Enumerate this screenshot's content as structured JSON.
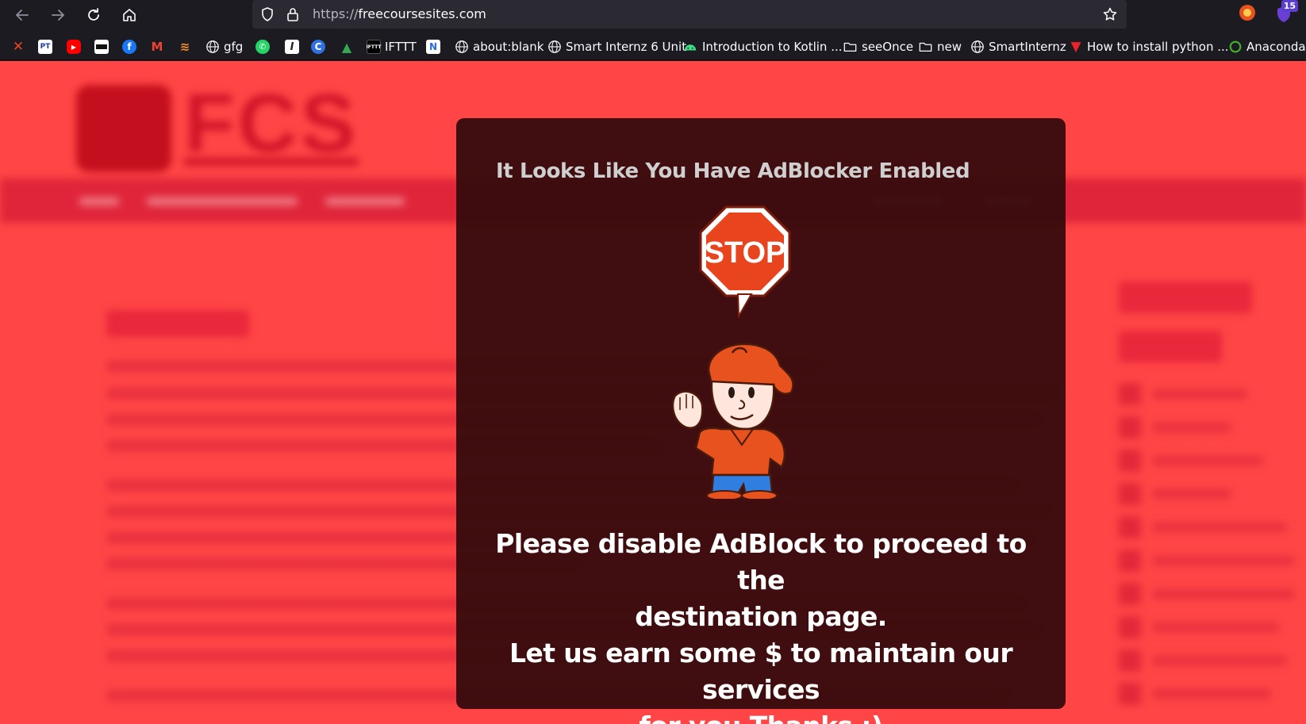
{
  "browser": {
    "url_protocol": "https://",
    "url_host": "freecoursesites.com",
    "extension_badge_count": "15"
  },
  "bookmarks": [
    {
      "label": "",
      "icon": "x-icon",
      "color": "#e8451e"
    },
    {
      "label": "",
      "icon": "pt-icon",
      "color": "#1a3aa8"
    },
    {
      "label": "",
      "icon": "youtube-icon",
      "color": "#ff0000"
    },
    {
      "label": "",
      "icon": "app-icon",
      "color": "#111111"
    },
    {
      "label": "",
      "icon": "facebook-icon",
      "color": "#1877f2"
    },
    {
      "label": "",
      "icon": "gmail-icon",
      "color": "#ea4335"
    },
    {
      "label": "",
      "icon": "layers-icon",
      "color": "#f28c28"
    },
    {
      "label": "gfg",
      "icon": "globe-icon",
      "color": ""
    },
    {
      "label": "",
      "icon": "whatsapp-icon",
      "color": "#25d366"
    },
    {
      "label": "",
      "icon": "italic-i-icon",
      "color": "#222222"
    },
    {
      "label": "",
      "icon": "canva-icon",
      "color": "#2f6fe0"
    },
    {
      "label": "",
      "icon": "drive-icon",
      "color": "#34a853"
    },
    {
      "label": "IFTTT",
      "icon": "ifttt-icon",
      "color": "#000000"
    },
    {
      "label": "",
      "icon": "notion-n-icon",
      "color": "#2c6bd6"
    },
    {
      "label": "about:blank",
      "icon": "globe-icon",
      "color": ""
    },
    {
      "label": "Smart Internz 6 Unit",
      "icon": "globe-icon",
      "color": ""
    },
    {
      "label": "Introduction to Kotlin ...",
      "icon": "android-icon",
      "color": "#3ddc84"
    },
    {
      "label": "seeOnce",
      "icon": "folder-icon",
      "color": ""
    },
    {
      "label": "new",
      "icon": "folder-icon",
      "color": ""
    },
    {
      "label": "SmartInternz",
      "icon": "globe-icon",
      "color": ""
    },
    {
      "label": "How to install python ...",
      "icon": "v-logo-icon",
      "color": "#e8232a"
    },
    {
      "label": "Anaconda",
      "icon": "anaconda-icon",
      "color": "#43b02a"
    }
  ],
  "modal": {
    "title": "It Looks Like You Have AdBlocker Enabled",
    "stop_sign_text": "STOP",
    "message_line1": "Please disable AdBlock to proceed to the",
    "message_line2": "destination page.",
    "message_line3": "Let us earn some $ to maintain our services",
    "message_line4": "for you Thanks :)"
  },
  "colors": {
    "page_background": "#ff4545",
    "modal_background": "#320a0c",
    "stop_sign": "#e8451e"
  }
}
